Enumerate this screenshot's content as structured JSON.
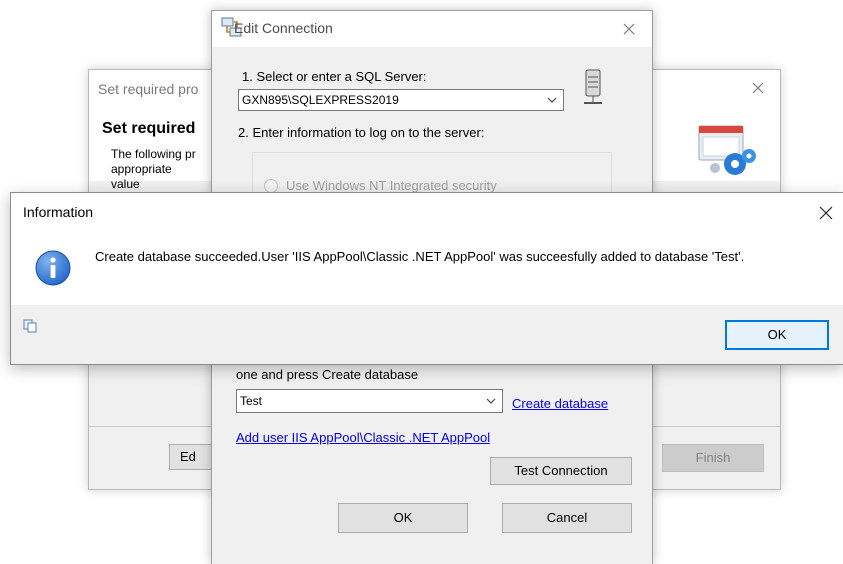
{
  "wizard": {
    "title": "Set required pro",
    "heading": "Set required",
    "description": "The following pr appropriate value",
    "edit_label": "Ed",
    "finish_label": "Finish"
  },
  "edit_connection": {
    "title": "Edit Connection",
    "step1_label": "1. Select or enter a SQL Server:",
    "server_value": "GXN895\\SQLEXPRESS2019",
    "step2_label": "2. Enter information to log on to the server:",
    "windows_auth_label": "Use Windows NT Integrated security",
    "step3_label": "one and press Create database",
    "database_value": "Test",
    "create_database_link": "Create database",
    "add_user_link": "Add user IIS AppPool\\Classic .NET AppPool",
    "test_connection_label": "Test Connection",
    "ok_label": "OK",
    "cancel_label": "Cancel"
  },
  "information": {
    "title": "Information",
    "message": "Create database succeeded.User 'IIS AppPool\\Classic .NET AppPool' was succeesfully added to database 'Test'.",
    "ok_label": "OK"
  },
  "colors": {
    "dialog_bg": "#f0f0f0",
    "link": "#0000ee",
    "focus_border": "#0078d7",
    "info_icon": "#1e63c9"
  },
  "icons": [
    "close-icon",
    "connection-icon",
    "server-icon",
    "settings-art-icon",
    "info-icon",
    "copy-icon",
    "chevron-down-icon"
  ]
}
